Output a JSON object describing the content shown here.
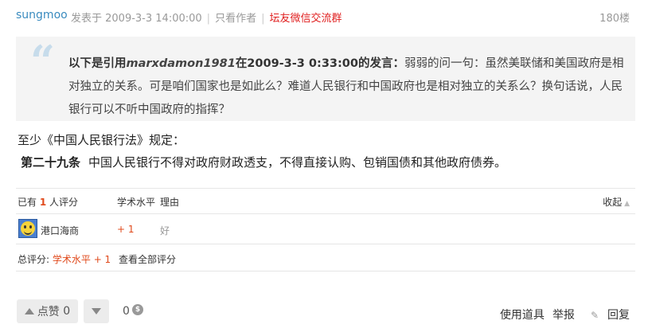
{
  "header": {
    "author": "sungmoo",
    "posted_at": "发表于 2009-3-3 14:00:00",
    "only_author": "只看作者",
    "wechat_group": "坛友微信交流群",
    "floor": "180楼"
  },
  "quote": {
    "prefix": "以下是引用",
    "quoted_user": "marxdamon1981",
    "quoted_meta": "在2009-3-3 0:33:00的发言：",
    "text": "弱弱的问一句：虽然美联储和美国政府是相对独立的关系。可是咱们国家也是如此么？难道人民银行和中国政府也是相对独立的关系么？换句话说，人民银行可以不听中国政府的指挥？"
  },
  "body": {
    "line1": "至少《中国人民银行法》规定：",
    "article": "第二十九条",
    "line2": "中国人民银行不得对政府财政透支，不得直接认购、包销国债和其他政府债券。"
  },
  "rating": {
    "header_prefix": "已有",
    "count": "1",
    "header_suffix": "人评分",
    "col_academic": "学术水平",
    "col_reason": "理由",
    "collapse": "收起",
    "rows": [
      {
        "name": "港口海商",
        "score": "+ 1",
        "reason": "好"
      }
    ],
    "total_label": "总评分:",
    "total_value": "学术水平 + 1",
    "view_all": "查看全部评分"
  },
  "footer": {
    "like_label": "点赞",
    "like_count": "0",
    "coin_count": "0",
    "use_tool": "使用道具",
    "report": "举报",
    "reply": "回复"
  }
}
